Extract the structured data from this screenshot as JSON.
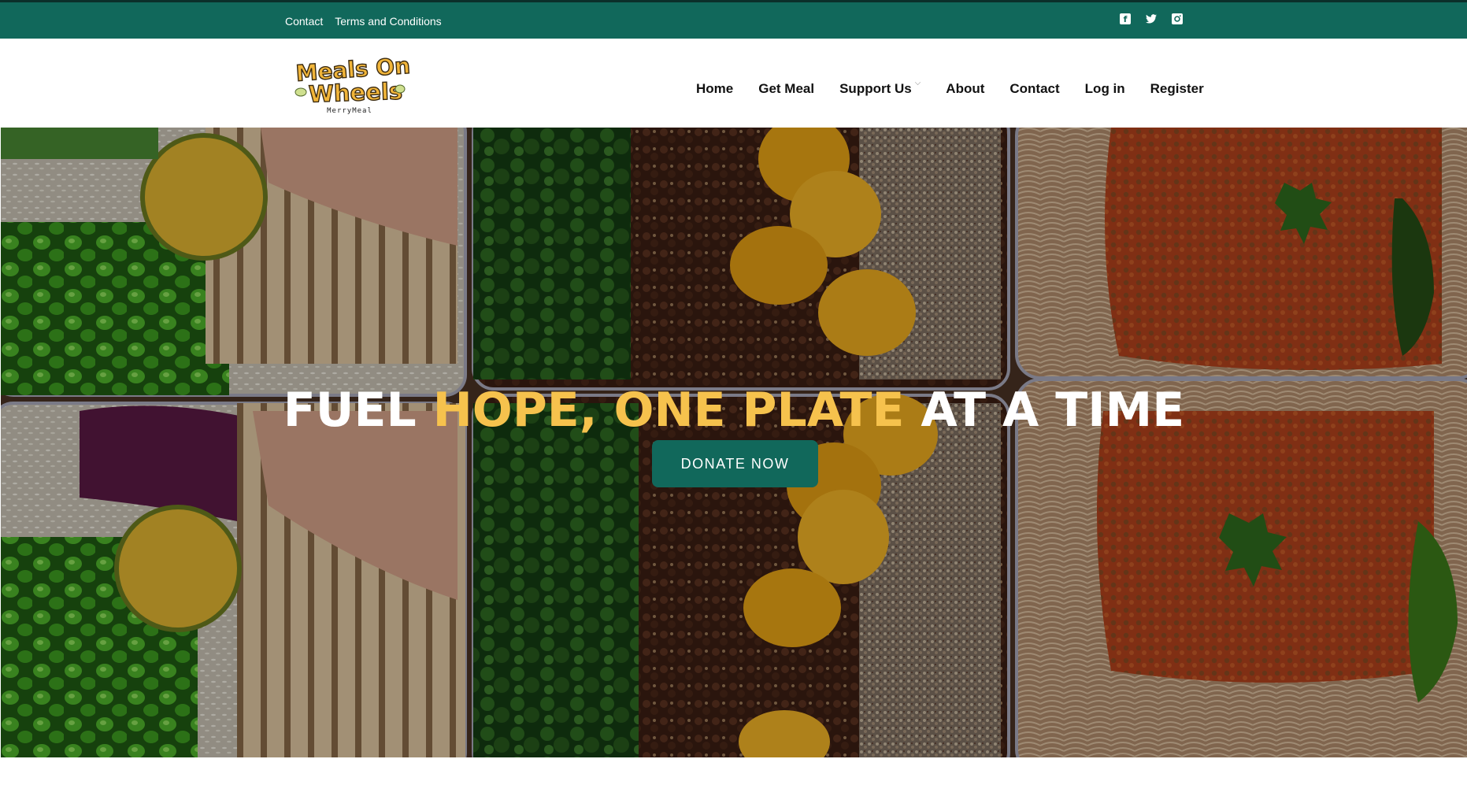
{
  "topbar": {
    "links": [
      "Contact",
      "Terms and Conditions"
    ],
    "social_icons": [
      "facebook-icon",
      "twitter-icon",
      "instagram-icon"
    ],
    "background_color": "#11685b"
  },
  "header": {
    "logo": {
      "line1": "Meals On",
      "line2": "Wheels",
      "tagline": "MerryMeal"
    },
    "nav": [
      {
        "label": "Home"
      },
      {
        "label": "Get Meal"
      },
      {
        "label": "Support Us",
        "has_dropdown": true
      },
      {
        "label": "About"
      },
      {
        "label": "Contact"
      },
      {
        "label": "Log in"
      },
      {
        "label": "Register"
      }
    ]
  },
  "hero": {
    "headline_part1": "FUEL ",
    "headline_highlight": "HOPE, ONE PLATE",
    "headline_part2": " AT A TIME",
    "cta_label": "DONATE NOW",
    "accent_color": "#f6c24d",
    "button_color": "#11685b"
  }
}
